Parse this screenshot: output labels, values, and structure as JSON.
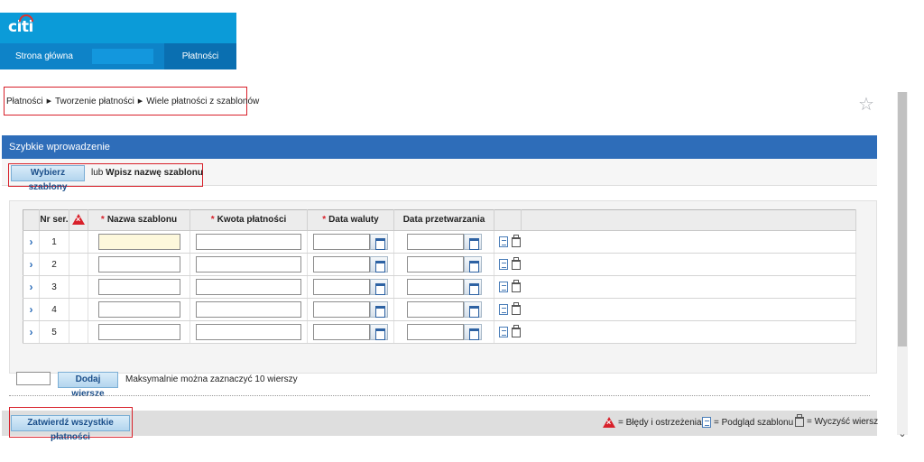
{
  "header": {
    "logo_text": "citi",
    "nav": {
      "home": "Strona główna",
      "payments": "Płatności"
    }
  },
  "breadcrumb": [
    "Płatności",
    "Tworzenie płatności",
    "Wiele płatności z szablonów"
  ],
  "quick_entry": {
    "title": "Szybkie wprowadzenie",
    "select_templates": "Wybierz szablony",
    "or": "lub",
    "type_name": "Wpisz nazwę szablonu"
  },
  "table": {
    "columns": {
      "nr": "Nr ser.",
      "template": "Nazwa szablonu",
      "amount": "Kwota płatności",
      "value_date": "Data waluty",
      "process_date": "Data przetwarzania"
    },
    "rows": [
      {
        "nr": "1"
      },
      {
        "nr": "2"
      },
      {
        "nr": "3"
      },
      {
        "nr": "4"
      },
      {
        "nr": "5"
      }
    ]
  },
  "add_rows": {
    "button": "Dodaj wiersze",
    "count_value": "",
    "max_text": "Maksymalnie można zaznaczyć 10 wierszy"
  },
  "footer": {
    "confirm": "Zatwierdź wszystkie płatności",
    "legend_errors": "= Błędy i ostrzeżenia",
    "legend_preview": "= Podgląd szablonu",
    "legend_clear": "= Wyczyść wiersz"
  },
  "colors": {
    "brand_blue": "#0b9bd8",
    "nav_blue": "#0e83c8",
    "section_blue": "#2e6db9",
    "highlight_red": "#d8202a"
  }
}
